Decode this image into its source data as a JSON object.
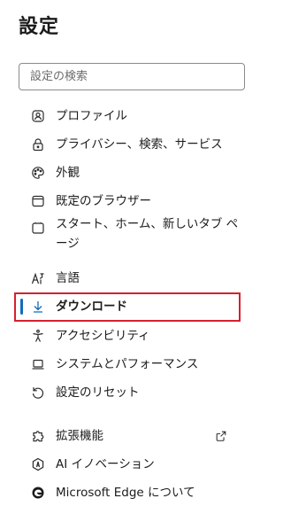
{
  "header": {
    "title": "設定"
  },
  "search": {
    "placeholder": "設定の検索"
  },
  "nav": {
    "profiles": "プロファイル",
    "privacy": "プライバシー、検索、サービス",
    "appearance": "外観",
    "default_browser": "既定のブラウザー",
    "start_home_newtab": "スタート、ホーム、新しいタブ ページ",
    "languages": "言語",
    "downloads": "ダウンロード",
    "accessibility": "アクセシビリティ",
    "system_performance": "システムとパフォーマンス",
    "reset": "設定のリセット",
    "extensions": "拡張機能",
    "ai_innovation": "AI イノベーション",
    "about": "Microsoft Edge について"
  },
  "colors": {
    "accent": "#0f6cbd",
    "highlight_box": "#d6202f"
  },
  "active_item": "downloads"
}
